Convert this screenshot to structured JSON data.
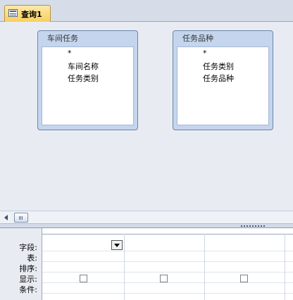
{
  "tab": {
    "label": "查询1",
    "icon": "query-table-icon"
  },
  "field_lists": [
    {
      "title": "车间任务",
      "fields": [
        "*",
        "车间名称",
        "任务类别"
      ]
    },
    {
      "title": "任务品种",
      "fields": [
        "*",
        "任务类别",
        "任务品种"
      ]
    }
  ],
  "grid": {
    "row_labels": [
      "字段:",
      "表:",
      "排序:",
      "显示:",
      "条件:"
    ],
    "show_checkboxes": 3
  },
  "colors": {
    "tab_active": "#f9cf5d",
    "field_list_frame": "#c4d5ed",
    "background": "#e8ecf2"
  }
}
